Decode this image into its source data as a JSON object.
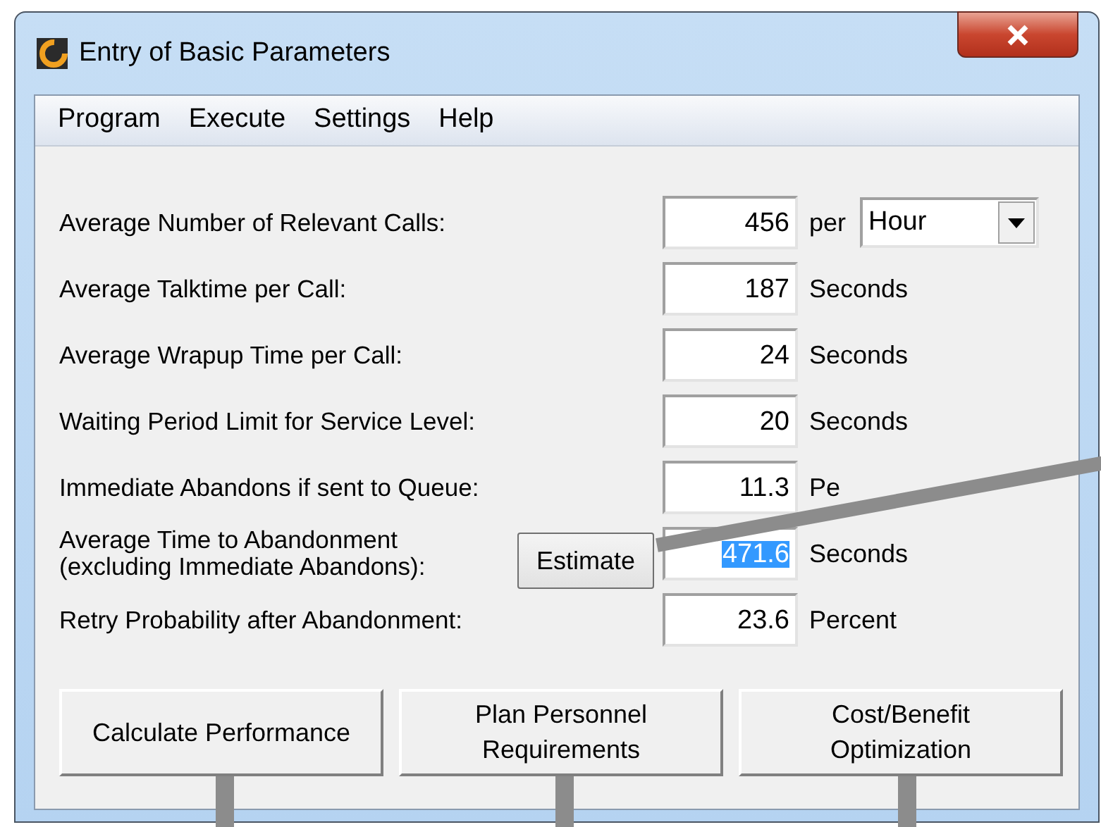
{
  "window": {
    "title": "Entry of Basic Parameters"
  },
  "menu": [
    "Program",
    "Execute",
    "Settings",
    "Help"
  ],
  "rows": [
    {
      "kind": "dropdown",
      "label": "Average Number of Relevant Calls:",
      "value": "456",
      "unit": "per",
      "dropdown": "Hour",
      "selected": false
    },
    {
      "kind": "plain",
      "label": "Average Talktime per Call:",
      "value": "187",
      "unit": "Seconds",
      "selected": false
    },
    {
      "kind": "plain",
      "label": "Average Wrapup Time per Call:",
      "value": "24",
      "unit": "Seconds",
      "selected": false
    },
    {
      "kind": "plain",
      "label": "Waiting Period Limit for Service Level:",
      "value": "20",
      "unit": "Seconds",
      "selected": false
    },
    {
      "kind": "plain",
      "label": "Immediate Abandons if sent to Queue:",
      "value": "11.3",
      "unit": "Pe",
      "selected": false
    },
    {
      "kind": "estimate",
      "label": "Average Time to Abandonment",
      "label2": "(excluding Immediate Abandons):",
      "button": "Estimate",
      "value": "471.6",
      "unit": "Seconds",
      "selected": true
    },
    {
      "kind": "plain",
      "label": "Retry Probability after Abandonment:",
      "value": "23.6",
      "unit": "Percent",
      "selected": false
    }
  ],
  "buttons": [
    [
      "Calculate Performance"
    ],
    [
      "Plan Personnel",
      "Requirements"
    ],
    [
      "Cost/Benefit",
      "Optimization"
    ]
  ]
}
